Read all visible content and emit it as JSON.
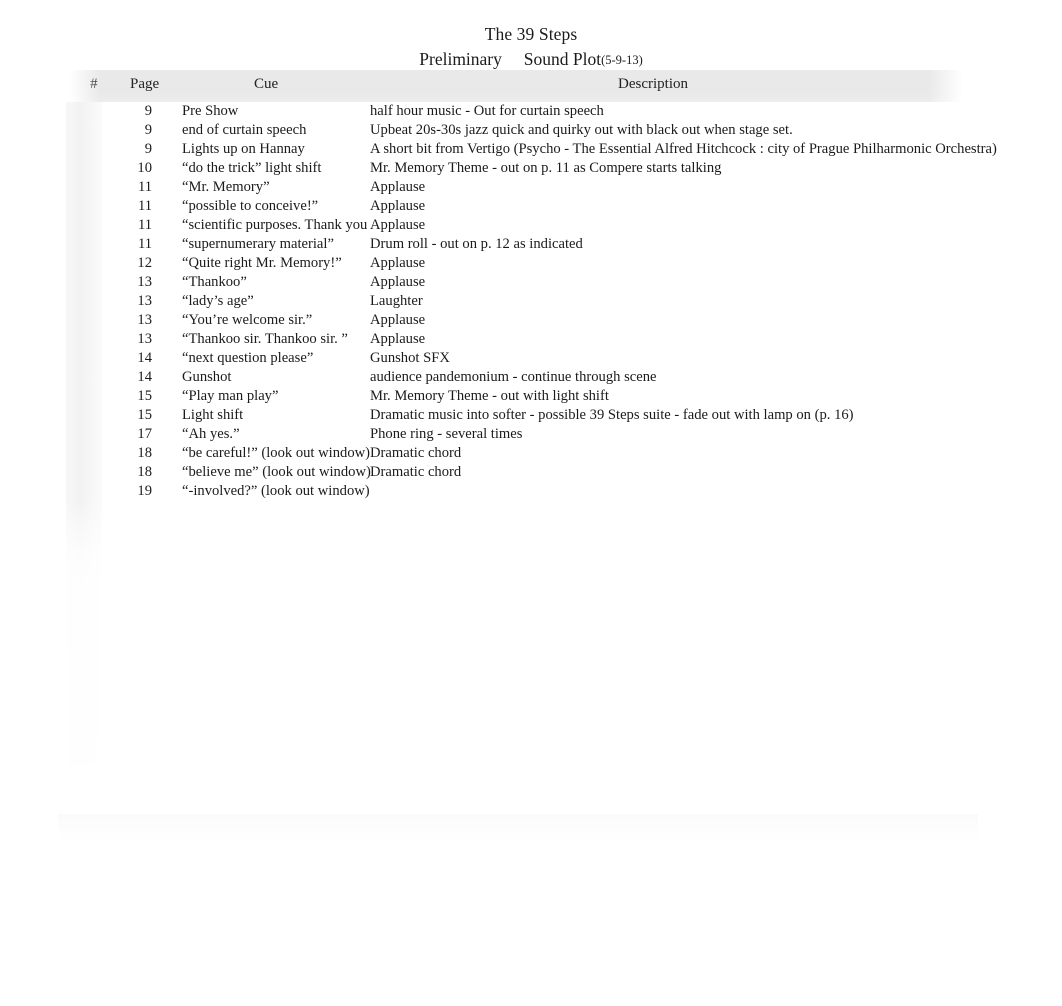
{
  "document": {
    "title": "The 39 Steps",
    "subtitle": "Preliminary     Sound Plot",
    "revision": "(5-9-13)"
  },
  "table": {
    "headers": {
      "number": "#",
      "page": "Page",
      "cue": "Cue",
      "description": "Description"
    },
    "rows": [
      {
        "num": "",
        "page": "9",
        "cue": "Pre Show",
        "desc": "half hour music - Out for curtain speech"
      },
      {
        "num": "",
        "page": "9",
        "cue": "end of curtain speech",
        "desc": "Upbeat 20s-30s jazz quick and quirky out with black out when stage set."
      },
      {
        "num": "",
        "page": "9",
        "cue": "Lights up on Hannay",
        "desc": "A short bit from Vertigo    (Psycho - The Essential Alfred Hitchcock    : city of Prague Philharmonic Orchestra)"
      },
      {
        "num": "",
        "page": "10",
        "cue": "“do the trick” light shift",
        "desc": "Mr. Memory Theme - out on p. 11 as Compere starts talking"
      },
      {
        "num": "",
        "page": "11",
        "cue": "“Mr. Memory”",
        "desc": "Applause"
      },
      {
        "num": "",
        "page": "11",
        "cue": "“possible to conceive!”",
        "desc": "Applause"
      },
      {
        "num": "",
        "page": "11",
        "cue": "“scientific purposes. Thank you",
        "desc": "Applause"
      },
      {
        "num": "",
        "page": "11",
        "cue": "“supernumerary material”",
        "desc": "Drum roll - out on p. 12 as indicated"
      },
      {
        "num": "",
        "page": "12",
        "cue": "“Quite right Mr. Memory!”",
        "desc": "Applause"
      },
      {
        "num": "",
        "page": "13",
        "cue": "“Thankoo”",
        "desc": "Applause"
      },
      {
        "num": "",
        "page": "13",
        "cue": "“lady’s age”",
        "desc": "Laughter"
      },
      {
        "num": "",
        "page": "13",
        "cue": "“You’re welcome sir.”",
        "desc": "Applause"
      },
      {
        "num": "",
        "page": "13",
        "cue": "“Thankoo sir. Thankoo sir. ”",
        "desc": "Applause"
      },
      {
        "num": "",
        "page": "14",
        "cue": "“next question please”",
        "desc": "Gunshot SFX"
      },
      {
        "num": "",
        "page": "14",
        "cue": "Gunshot",
        "desc": "audience pandemonium - continue through scene"
      },
      {
        "num": "",
        "page": "15",
        "cue": "“Play man play”",
        "desc": "Mr. Memory Theme - out with light shift"
      },
      {
        "num": "",
        "page": "15",
        "cue": "Light shift",
        "desc": "Dramatic music into softer - possible 39 Steps suite - fade out with lamp on (p. 16)"
      },
      {
        "num": "",
        "page": "17",
        "cue": "“Ah yes.”",
        "desc": "Phone ring - several times"
      },
      {
        "num": "",
        "page": "18",
        "cue": "“be careful!” (look out window)",
        "desc": "Dramatic chord"
      },
      {
        "num": "",
        "page": "18",
        "cue": "“believe me” (look out window)",
        "desc": "Dramatic chord"
      },
      {
        "num": "",
        "page": "19",
        "cue": "“-involved?” (look out window)",
        "desc": ""
      },
      {
        "num": "",
        "page": "",
        "cue": "",
        "desc": ""
      },
      {
        "num": "",
        "page": "",
        "cue": "",
        "desc": ""
      },
      {
        "num": "",
        "page": "",
        "cue": "",
        "desc": ""
      },
      {
        "num": "",
        "page": "",
        "cue": "",
        "desc": ""
      },
      {
        "num": "",
        "page": "",
        "cue": "",
        "desc": ""
      },
      {
        "num": "",
        "page": "",
        "cue": "",
        "desc": ""
      },
      {
        "num": "",
        "page": "",
        "cue": "",
        "desc": ""
      },
      {
        "num": "",
        "page": "",
        "cue": "",
        "desc": ""
      },
      {
        "num": "",
        "page": "",
        "cue": "",
        "desc": ""
      },
      {
        "num": "",
        "page": "",
        "cue": "",
        "desc": ""
      },
      {
        "num": "",
        "page": "",
        "cue": "",
        "desc": ""
      },
      {
        "num": "",
        "page": "",
        "cue": "",
        "desc": ""
      }
    ]
  }
}
